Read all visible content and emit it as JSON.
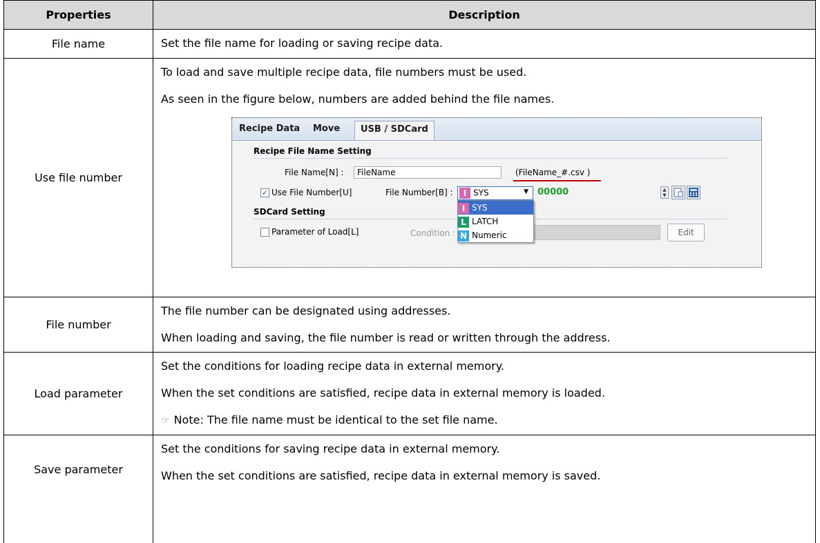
{
  "header": {
    "col1": "Properties",
    "col2": "Description"
  },
  "rows": [
    {
      "property": "File name",
      "lines": [
        "Set the file name for loading or saving recipe data."
      ]
    },
    {
      "property": "Use file number",
      "lines": [
        "To load and save multiple recipe data, file numbers must be used.",
        "As seen in the figure below, numbers are added behind the file names."
      ]
    },
    {
      "property": "File number",
      "lines": [
        "The file number can be designated using addresses.",
        "When loading and saving, the file number is read or written through the address."
      ]
    },
    {
      "property": "Load parameter",
      "lines": [
        "Set the conditions for loading recipe data in external memory.",
        "When the set conditions are satisfied, recipe data in external memory is loaded."
      ],
      "note": "Note: The file name must be identical to the set file name."
    },
    {
      "property": "Save parameter",
      "lines": [
        "Set the conditions for saving recipe data in external memory.",
        "When the set conditions are satisfied, recipe data in external memory is saved."
      ]
    }
  ],
  "figure": {
    "tabs": [
      "Recipe Data",
      "Move",
      "USB / SDCard"
    ],
    "section_filename": "Recipe File Name Setting",
    "file_name_label": "File Name[N] :",
    "file_name_value": "FileName",
    "file_name_preview": "(FileName_#.csv )",
    "use_file_number_label": "Use File Number[U]",
    "file_number_label": "File Number[B] :",
    "combo_selected": "SYS",
    "number_value": "00000",
    "options": [
      {
        "badge": "I",
        "label": "SYS"
      },
      {
        "badge": "L",
        "label": "LATCH"
      },
      {
        "badge": "N",
        "label": "Numeric"
      }
    ],
    "section_sdcard": "SDCard Setting",
    "load_param_label": "Parameter of Load[L]",
    "condition_label": "Condition :",
    "edit_label": "Edit"
  }
}
